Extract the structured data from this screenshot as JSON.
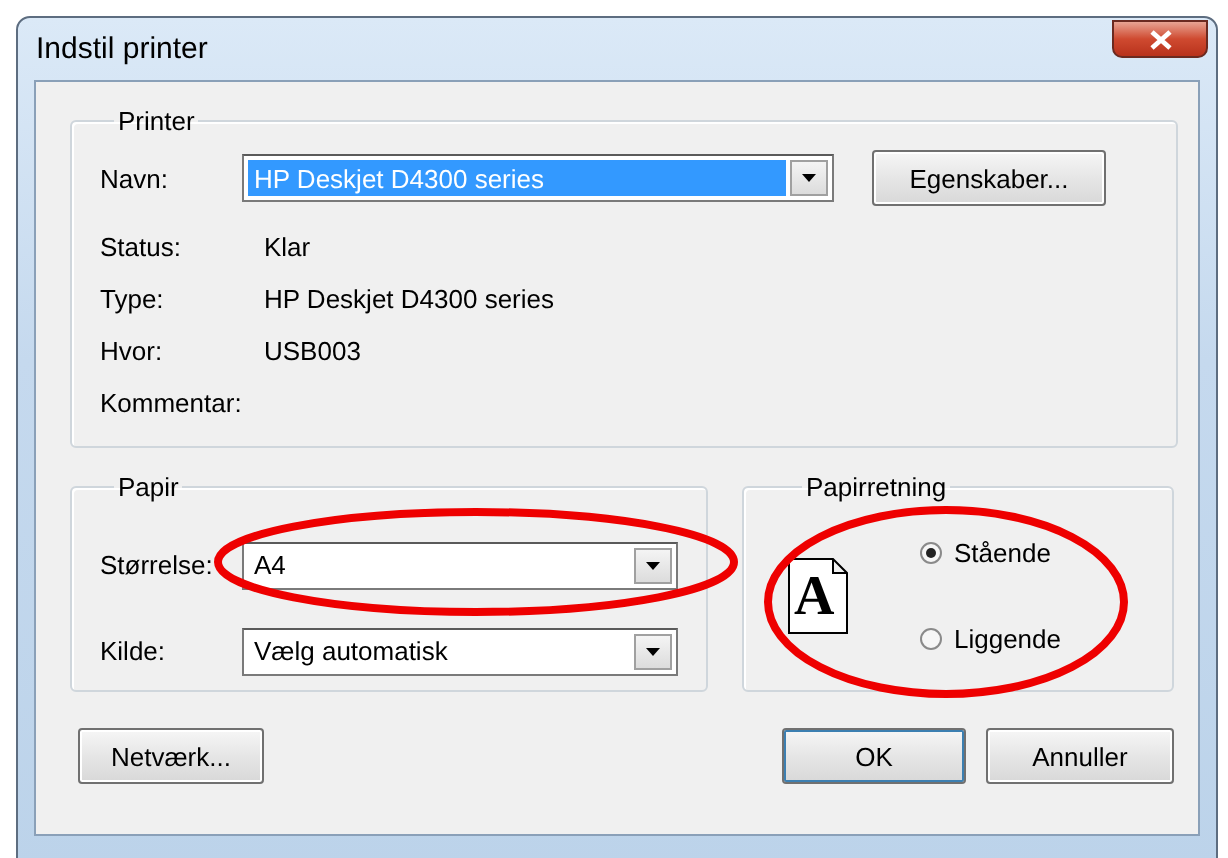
{
  "window": {
    "title": "Indstil printer"
  },
  "printer": {
    "title": "Printer",
    "name_label": "Navn:",
    "name_value": "HP Deskjet D4300 series",
    "properties_button": "Egenskaber...",
    "info": [
      {
        "label": "Status:",
        "value": "Klar"
      },
      {
        "label": "Type:",
        "value": "HP Deskjet D4300 series"
      },
      {
        "label": "Hvor:",
        "value": "USB003"
      },
      {
        "label": "Kommentar:"
      }
    ]
  },
  "paper": {
    "title": "Papir",
    "fields": [
      {
        "label": "Størrelse:",
        "value": "A4"
      },
      {
        "label": "Kilde:",
        "value": "Vælg automatisk"
      }
    ]
  },
  "orientation": {
    "title": "Papirretning",
    "icon_letter": "A",
    "options": [
      {
        "label": "Stående",
        "selected": true
      },
      {
        "label": "Liggende",
        "selected": false
      }
    ]
  },
  "buttons": {
    "network": "Netværk...",
    "ok": "OK",
    "cancel": "Annuller"
  }
}
